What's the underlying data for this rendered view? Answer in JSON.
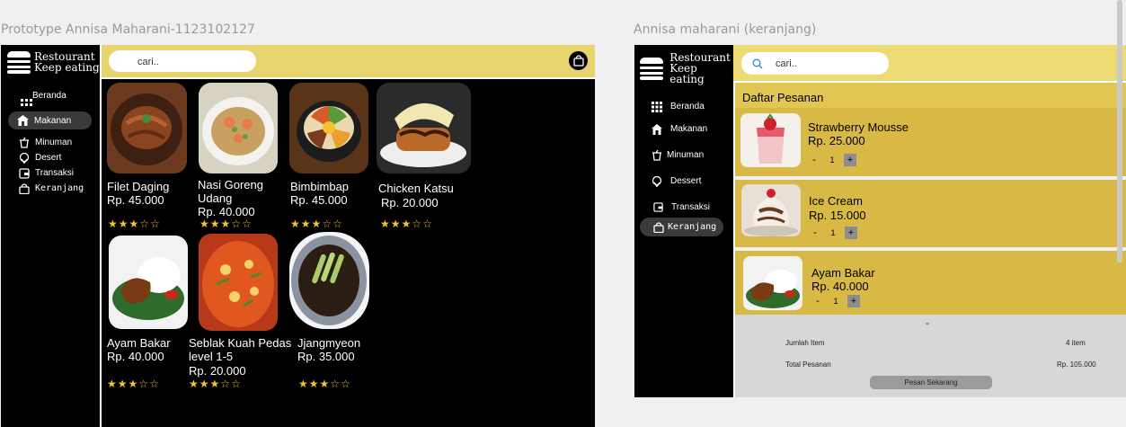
{
  "left": {
    "frame_title": "Prototype Annisa Maharani-1123102127",
    "logo": {
      "line1": "Restourant",
      "line2": "Keep eating"
    },
    "nav": [
      {
        "label": "Beranda",
        "icon": "grid-icon"
      },
      {
        "label": "Makanan",
        "icon": "home-icon"
      },
      {
        "label": "Minuman",
        "icon": "cup-icon"
      },
      {
        "label": "Desert",
        "icon": "dessert-icon"
      },
      {
        "label": "Transaksi",
        "icon": "wallet-icon"
      },
      {
        "label": "Keranjang",
        "icon": "bag-icon"
      }
    ],
    "search": {
      "placeholder": "cari.."
    },
    "cart_icon": "bag-icon",
    "menu_items": [
      {
        "name": "Filet Daging",
        "price": "Rp. 45.000",
        "rating": 3
      },
      {
        "name": "Nasi Goreng Udang",
        "price": "Rp. 40.000",
        "rating": 3
      },
      {
        "name": "Bimbimbap",
        "price": "Rp. 45.000",
        "rating": 3
      },
      {
        "name": "Chicken Katsu",
        "price": "Rp. 20.000",
        "rating": 3
      },
      {
        "name": "Ayam Bakar",
        "price": "Rp. 40.000",
        "rating": 3
      },
      {
        "name": "Seblak Kuah Pedas level 1-5",
        "price": "Rp. 20.000",
        "rating": 3
      },
      {
        "name": "Jjangmyeon",
        "price": "Rp. 35.000",
        "rating": 3
      }
    ]
  },
  "right": {
    "frame_title": "Annisa maharani (keranjang)",
    "logo": {
      "line1": "Restourant",
      "line2": "Keep eating"
    },
    "nav": [
      {
        "label": "Beranda",
        "icon": "grid-icon"
      },
      {
        "label": "Makanan",
        "icon": "home-icon"
      },
      {
        "label": "Minuman",
        "icon": "cup-icon"
      },
      {
        "label": "Dessert",
        "icon": "dessert-icon"
      },
      {
        "label": "Transaksi",
        "icon": "wallet-icon"
      },
      {
        "label": "Keranjang",
        "icon": "bag-icon"
      }
    ],
    "search": {
      "placeholder": "cari.."
    },
    "heading": "Daftar Pesanan",
    "orders": [
      {
        "name": "Strawberry Mousse",
        "price": "Rp. 25.000",
        "qty": "1"
      },
      {
        "name": "Ice Cream",
        "price": "Rp. 15.000",
        "qty": "1"
      },
      {
        "name": "Ayam Bakar",
        "price": "Rp. 40.000",
        "qty": "1"
      }
    ],
    "stepper": {
      "minus": "-",
      "plus": "+"
    },
    "summary": {
      "collapse": "-",
      "items_label": "Jumlah Item",
      "items_value": "4 item",
      "total_label": "Total Pesanan",
      "total_value": "Rp. 105.000",
      "order_button": "Pesan Sekarang"
    }
  },
  "colors": {
    "accent_yellow": "#e7d46d",
    "card_gold": "#d9b945",
    "star": "#f2c530"
  }
}
